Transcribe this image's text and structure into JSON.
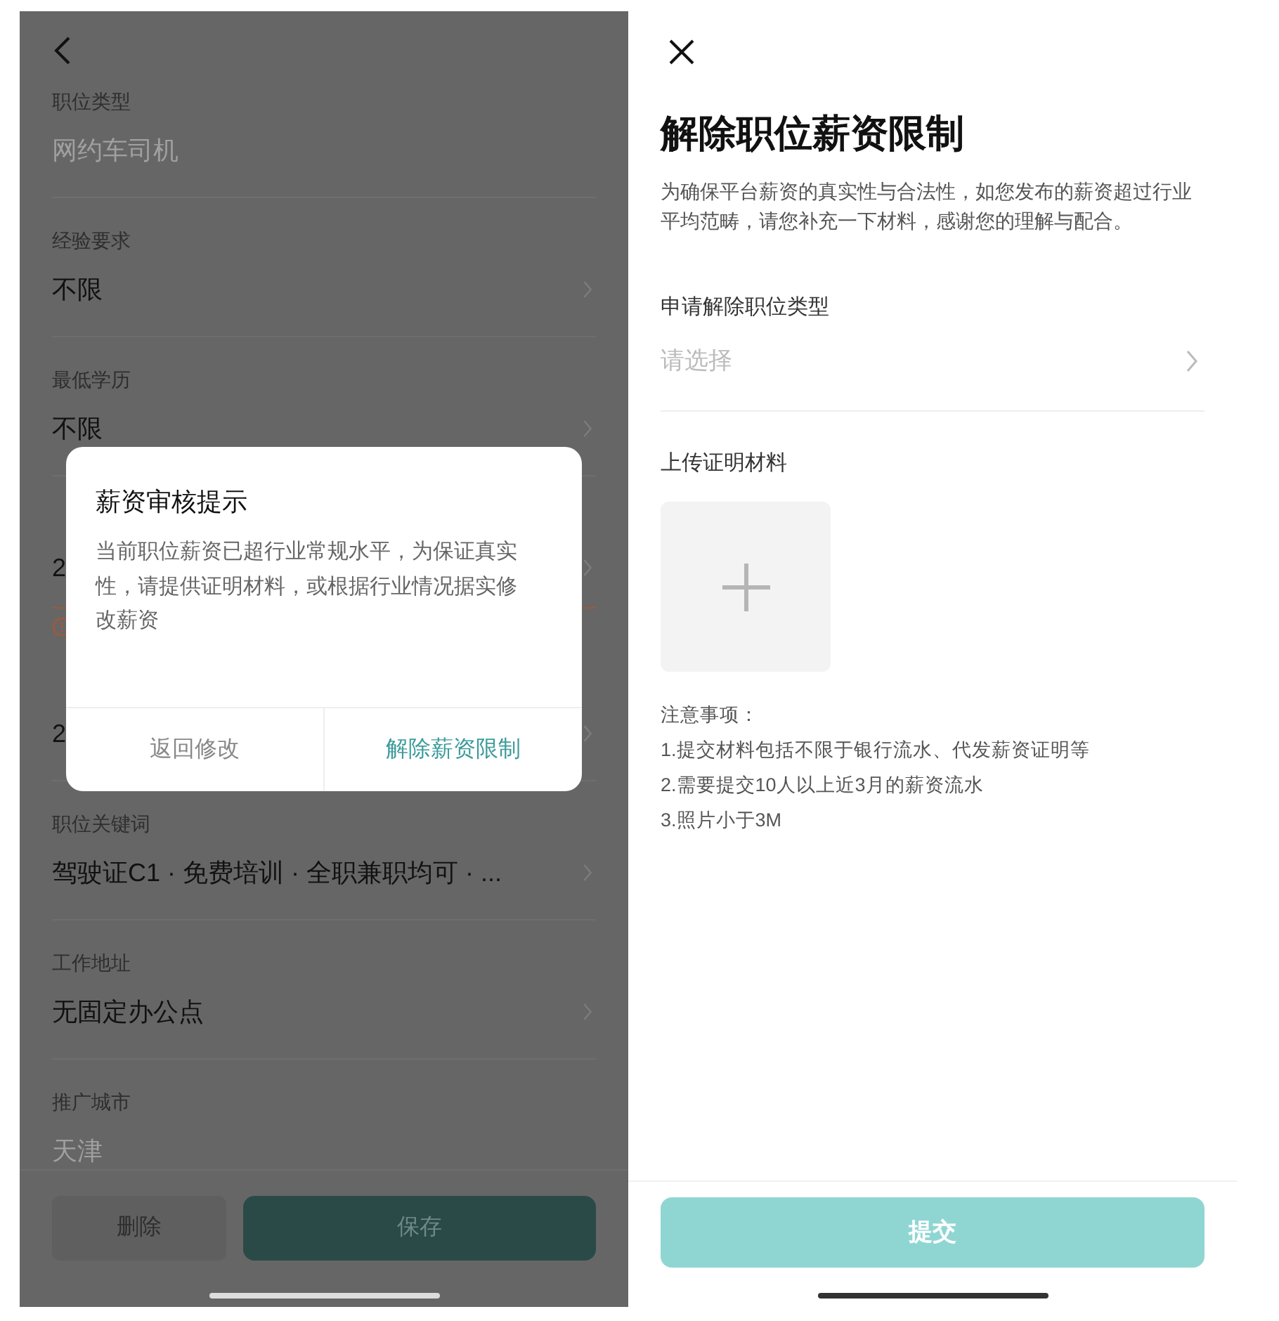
{
  "job_form": {
    "fields": [
      {
        "label": "职位类型",
        "value": "网约车司机",
        "disabled": true,
        "error": false
      },
      {
        "label": "经验要求",
        "value": "不限",
        "disabled": false,
        "error": false
      },
      {
        "label": "最低学历",
        "value": "不限",
        "disabled": false,
        "error": false
      },
      {
        "value": "2",
        "disabled": false,
        "error": true
      },
      {
        "value": "2",
        "disabled": false,
        "error": false
      },
      {
        "label": "职位关键词",
        "value": "驾驶证C1 · 免费培训 · 全职兼职均可 · ...",
        "disabled": false,
        "error": false
      },
      {
        "label": "工作地址",
        "value": "无固定办公点",
        "disabled": false,
        "error": false
      },
      {
        "label": "推广城市",
        "value": "天津",
        "disabled": true,
        "error": false
      }
    ],
    "buttons": {
      "delete": "删除",
      "save": "保存"
    }
  },
  "dialog": {
    "title": "薪资审核提示",
    "message": "当前职位薪资已超行业常规水平，为保证真实性，请提供证明材料，或根据行业情况据实修改薪资",
    "cancel": "返回修改",
    "confirm": "解除薪资限制"
  },
  "release_page": {
    "title": "解除职位薪资限制",
    "description": "为确保平台薪资的真实性与合法性，如您发布的薪资超过行业平均范畴，请您补充一下材料，感谢您的理解与配合。",
    "type_field": {
      "label": "申请解除职位类型",
      "placeholder": "请选择"
    },
    "upload": {
      "label": "上传证明材料"
    },
    "notes": [
      "注意事项：",
      "1.提交材料包括不限于银行流水、代发薪资证明等",
      "2.需要提交10人以上近3月的薪资流水",
      "3.照片小于3M"
    ],
    "submit": {
      "label": "提交",
      "disabled": true
    }
  }
}
